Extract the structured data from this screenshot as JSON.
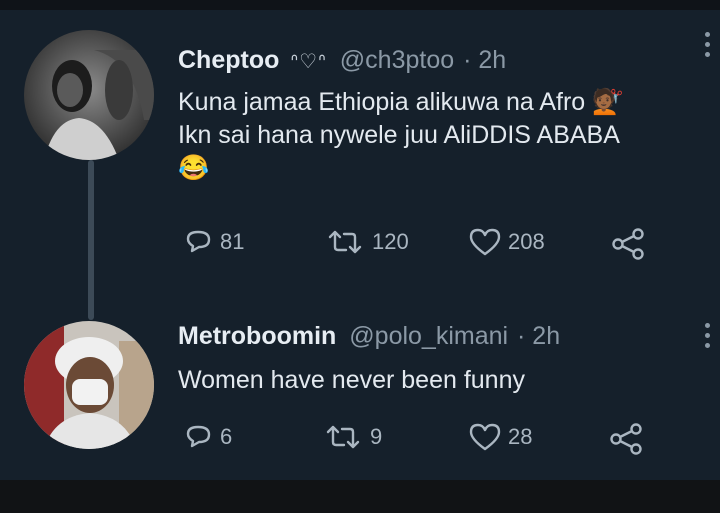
{
  "tweets": [
    {
      "name": "Cheptoo",
      "badge": "ᐢ♡ᐢ",
      "handle": "@ch3ptoo",
      "time": "· 2h",
      "lines": [
        "Kuna jamaa Ethiopia alikuwa na Afro 💇🏾",
        "Ikn sai hana nywele juu AliDDIS ABABA",
        "😂"
      ],
      "reply_count": "81",
      "retweet_count": "120",
      "like_count": "208"
    },
    {
      "name": "Metroboomin",
      "handle": "@polo_kimani",
      "time": "· 2h",
      "lines": [
        "Women have never been funny"
      ],
      "reply_count": "6",
      "retweet_count": "9",
      "like_count": "28"
    }
  ],
  "icons": {
    "reply": "reply-icon",
    "retweet": "retweet-icon",
    "like": "heart-icon",
    "share": "share-icon",
    "more": "more-vertical-icon"
  },
  "colors": {
    "background": "#15202b",
    "text": "#e3e9ef",
    "muted": "#8b99a6"
  }
}
